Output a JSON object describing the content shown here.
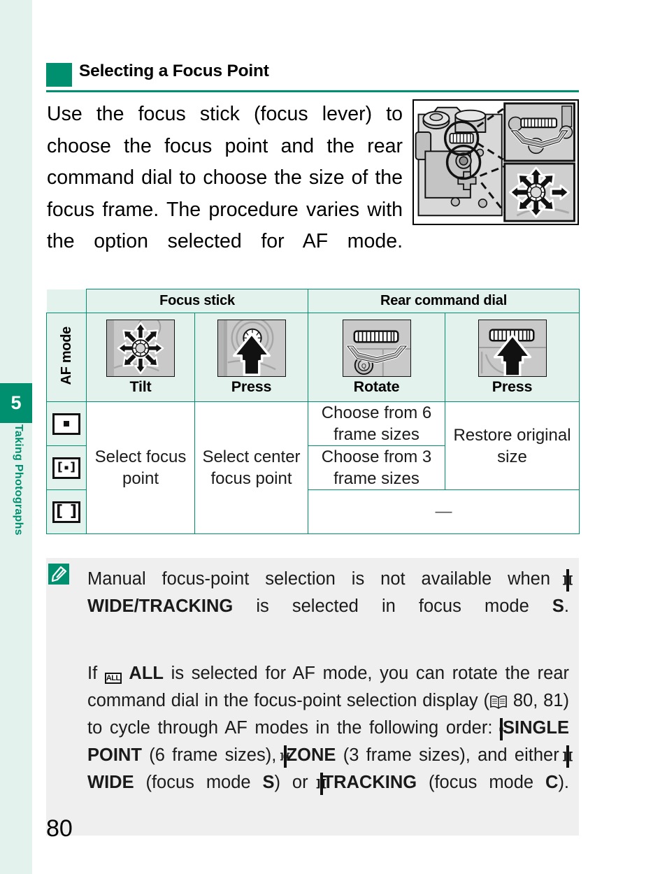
{
  "sidebar": {
    "chapter_number": "5",
    "chapter_label": "Taking Photographs",
    "accent_color": "#009070",
    "background_color": "#e3f2ec"
  },
  "heading": {
    "title": "Selecting a Focus Point",
    "marker_color": "#009070"
  },
  "intro": {
    "text": "Use the focus stick (focus lever) to choose the focus point and the rear command dial to choose the size of the focus frame. The procedure varies with the option selected for AF mode."
  },
  "figure": {
    "caption": "camera-rear-view-with-focus-stick-and-rear-command-dial-callouts"
  },
  "table": {
    "group_headers": [
      {
        "label": "Focus stick",
        "span": 2
      },
      {
        "label": "Rear command dial",
        "span": 2
      }
    ],
    "row_header_label": "AF mode",
    "action_columns": [
      {
        "caption": "Tilt",
        "icon": "focus-stick-tilt-eight-way-arrows"
      },
      {
        "caption": "Press",
        "icon": "focus-stick-press-up-arrow"
      },
      {
        "caption": "Rotate",
        "icon": "rear-command-dial-rotate-curved-arrow"
      },
      {
        "caption": "Press",
        "icon": "rear-command-dial-press-up-arrow"
      }
    ],
    "rows": [
      {
        "af_mode_icon": "single-point-icon",
        "tilt": "Select focus point",
        "press_stick": "Select center focus point",
        "rotate": "Choose from 6 frame sizes",
        "press_dial": "Restore original size"
      },
      {
        "af_mode_icon": "zone-icon",
        "tilt": "Select focus point",
        "press_stick": "Select center focus point",
        "rotate": "Choose from 3 frame sizes",
        "press_dial": "Restore original size"
      },
      {
        "af_mode_icon": "wide-tracking-icon",
        "tilt": "Select focus point",
        "press_stick": "Select center focus point",
        "rotate": "—",
        "press_dial": "—"
      }
    ],
    "merged_cells": {
      "tilt_all_rows": "Select focus point",
      "press_stick_all_rows": "Select center focus point",
      "rotate_row1": "Choose from 6 frame sizes",
      "rotate_row2": "Choose from 3 frame sizes",
      "press_dial_rows_1_2": "Restore original size",
      "last_row_dash": "—"
    },
    "border_color": "#009070",
    "header_background": "#e3f2ec"
  },
  "note": {
    "icon": "note-pen-icon",
    "background_color": "#efefef",
    "paragraph1": {
      "lead": "Manual focus-point selection is not available when",
      "icon1": "wide-tracking-icon",
      "bold1": "WIDE/TRACKING",
      "mid": "is selected in focus mode",
      "bold2": "S",
      "tail": "."
    },
    "paragraph2": {
      "s1": "If",
      "icon_all": "all-icon",
      "bold_all": "ALL",
      "s2": "is selected for AF mode, you can rotate the rear command dial in the focus-point selection display (",
      "icon_book": "book-reference-icon",
      "pages": "80, 81",
      "s3": ") to cycle through AF modes in the following order:",
      "icon_single": "single-point-icon",
      "bold_single": "SINGLE POINT",
      "s4": "(6 frame sizes),",
      "icon_zone": "zone-icon",
      "bold_zone": "ZONE",
      "s5": "(3 frame sizes), and either",
      "icon_wide": "wide-icon",
      "bold_wide": "WIDE",
      "s6": "(focus mode",
      "bold_s": "S",
      "s7": ") or",
      "icon_tracking": "tracking-icon",
      "bold_tracking": "TRACKING",
      "s8": "(focus mode",
      "bold_c": "C",
      "s9": ")."
    }
  },
  "footer": {
    "page_number": "80"
  }
}
